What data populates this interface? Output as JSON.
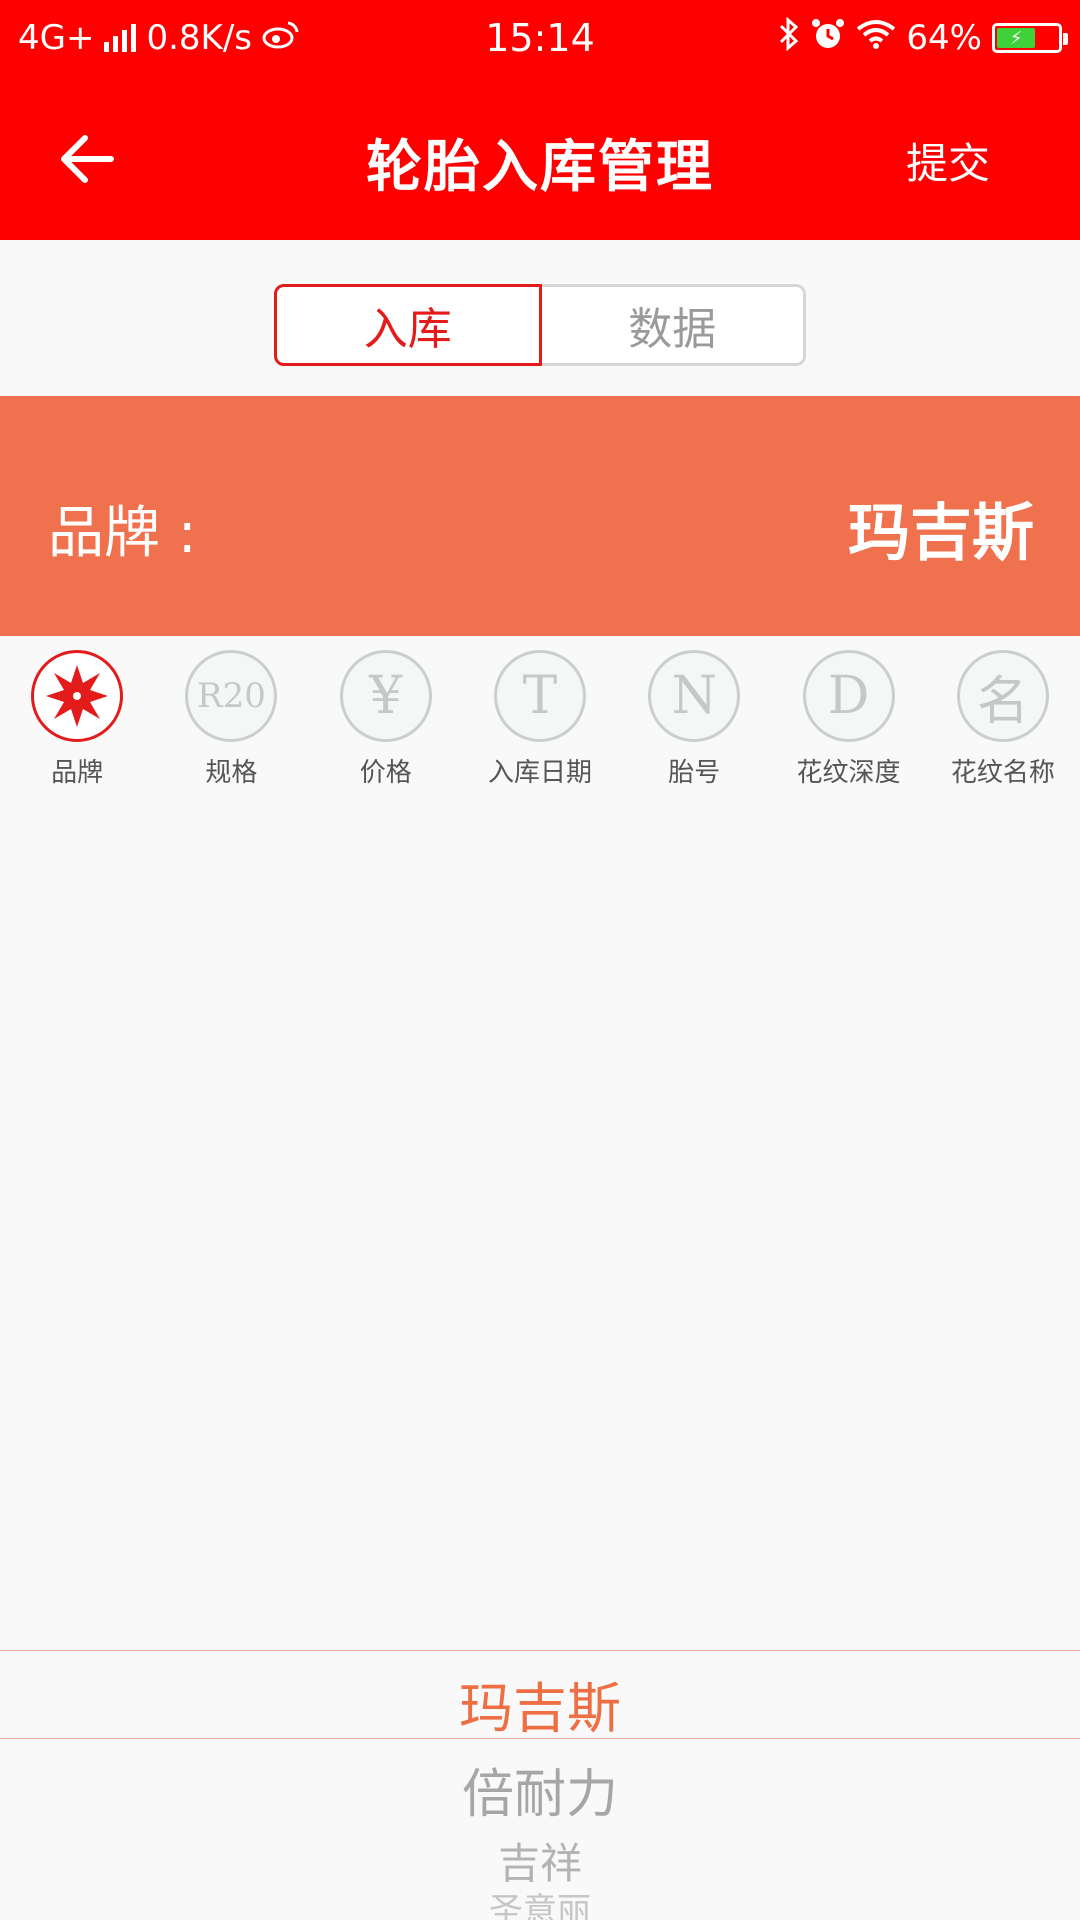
{
  "status_bar": {
    "network": "4G+",
    "speed": "0.8K/s",
    "time": "15:14",
    "battery": "64%"
  },
  "header": {
    "title": "轮胎入库管理",
    "submit_label": "提交"
  },
  "tabs": [
    {
      "label": "入库",
      "active": true
    },
    {
      "label": "数据",
      "active": false
    }
  ],
  "selection": {
    "label": "品牌 :",
    "value": "玛吉斯"
  },
  "steps": [
    {
      "label": "品牌",
      "glyph": "",
      "icon": "star-burst-icon",
      "active": true
    },
    {
      "label": "规格",
      "glyph": "R20",
      "icon": "r20-icon",
      "active": false
    },
    {
      "label": "价格",
      "glyph": "¥",
      "icon": "yuan-icon",
      "active": false
    },
    {
      "label": "入库日期",
      "glyph": "T",
      "icon": "t-letter-icon",
      "active": false
    },
    {
      "label": "胎号",
      "glyph": "N",
      "icon": "n-letter-icon",
      "active": false
    },
    {
      "label": "花纹深度",
      "glyph": "D",
      "icon": "d-letter-icon",
      "active": false
    },
    {
      "label": "花纹名称",
      "glyph": "名",
      "icon": "name-char-icon",
      "active": false
    }
  ],
  "picker": {
    "selected": "玛吉斯",
    "options": [
      "倍耐力",
      "吉祥",
      "圣意丽"
    ]
  },
  "colors": {
    "primary": "#fe0000",
    "accent": "#f0714d",
    "active_text": "#e31b1b"
  }
}
